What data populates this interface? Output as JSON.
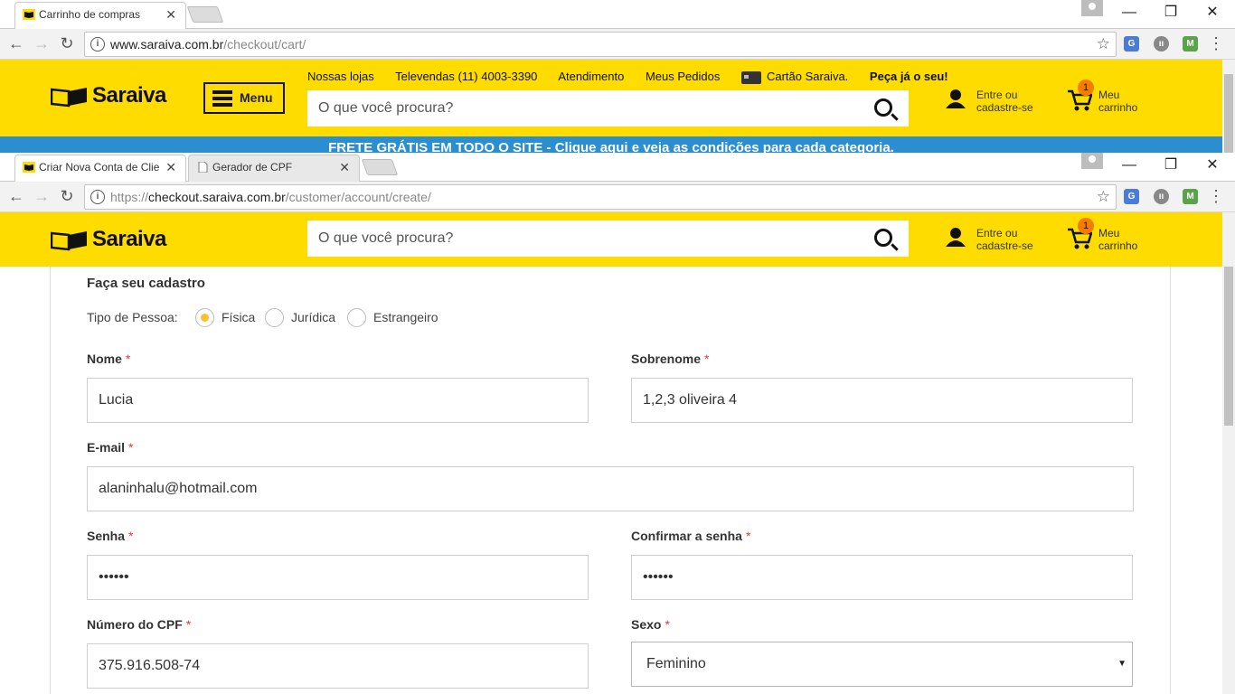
{
  "back_window": {
    "tabs": [
      {
        "title": "Carrinho de compras"
      }
    ],
    "address": {
      "host": "www.saraiva.com.br",
      "path": "/checkout/cart/"
    },
    "top_links": [
      "Nossas lojas",
      "Televendas (11) 4003-3390",
      "Atendimento",
      "Meus Pedidos"
    ],
    "card_promo": {
      "text": "Cartão Saraiva.",
      "bold": "Peça já o seu!"
    },
    "menu_label": "Menu",
    "banner": "FRETE GRÁTIS EM TODO O SITE - Clique aqui e veja as condições para cada categoria."
  },
  "front_window": {
    "tabs": [
      {
        "title": "Criar Nova Conta de Clie"
      },
      {
        "title": "Gerador de CPF"
      }
    ],
    "address": {
      "scheme": "https://",
      "host": "checkout.saraiva.com.br",
      "path": "/customer/account/create/"
    }
  },
  "header": {
    "logo": "Saraiva",
    "search_placeholder": "O que você procura?",
    "account": {
      "line1": "Entre ou",
      "line2": "cadastre-se"
    },
    "cart": {
      "count": "1",
      "line1": "Meu",
      "line2": "carrinho"
    }
  },
  "form": {
    "title": "Faça seu cadastro",
    "tipo_label": "Tipo de Pessoa:",
    "tipo_options": [
      "Física",
      "Jurídica",
      "Estrangeiro"
    ],
    "tipo_selected": "Física",
    "required_mark": "*",
    "fields": {
      "nome": {
        "label": "Nome",
        "value": "Lucia"
      },
      "sobrenome": {
        "label": "Sobrenome",
        "value": "1,2,3 oliveira 4"
      },
      "email": {
        "label": "E-mail",
        "value": "alaninhalu@hotmail.com"
      },
      "senha": {
        "label": "Senha",
        "value": "••••••"
      },
      "confirmar": {
        "label": "Confirmar a senha",
        "value": "••••••"
      },
      "cpf": {
        "label": "Número do CPF",
        "value": "375.916.508-74"
      },
      "sexo": {
        "label": "Sexo",
        "value": "Feminino"
      }
    }
  },
  "colors": {
    "brand_yellow": "#fedc00",
    "banner_blue": "#2a8ed1",
    "badge_orange": "#f57c00",
    "radio_selected": "#fbc02d"
  }
}
